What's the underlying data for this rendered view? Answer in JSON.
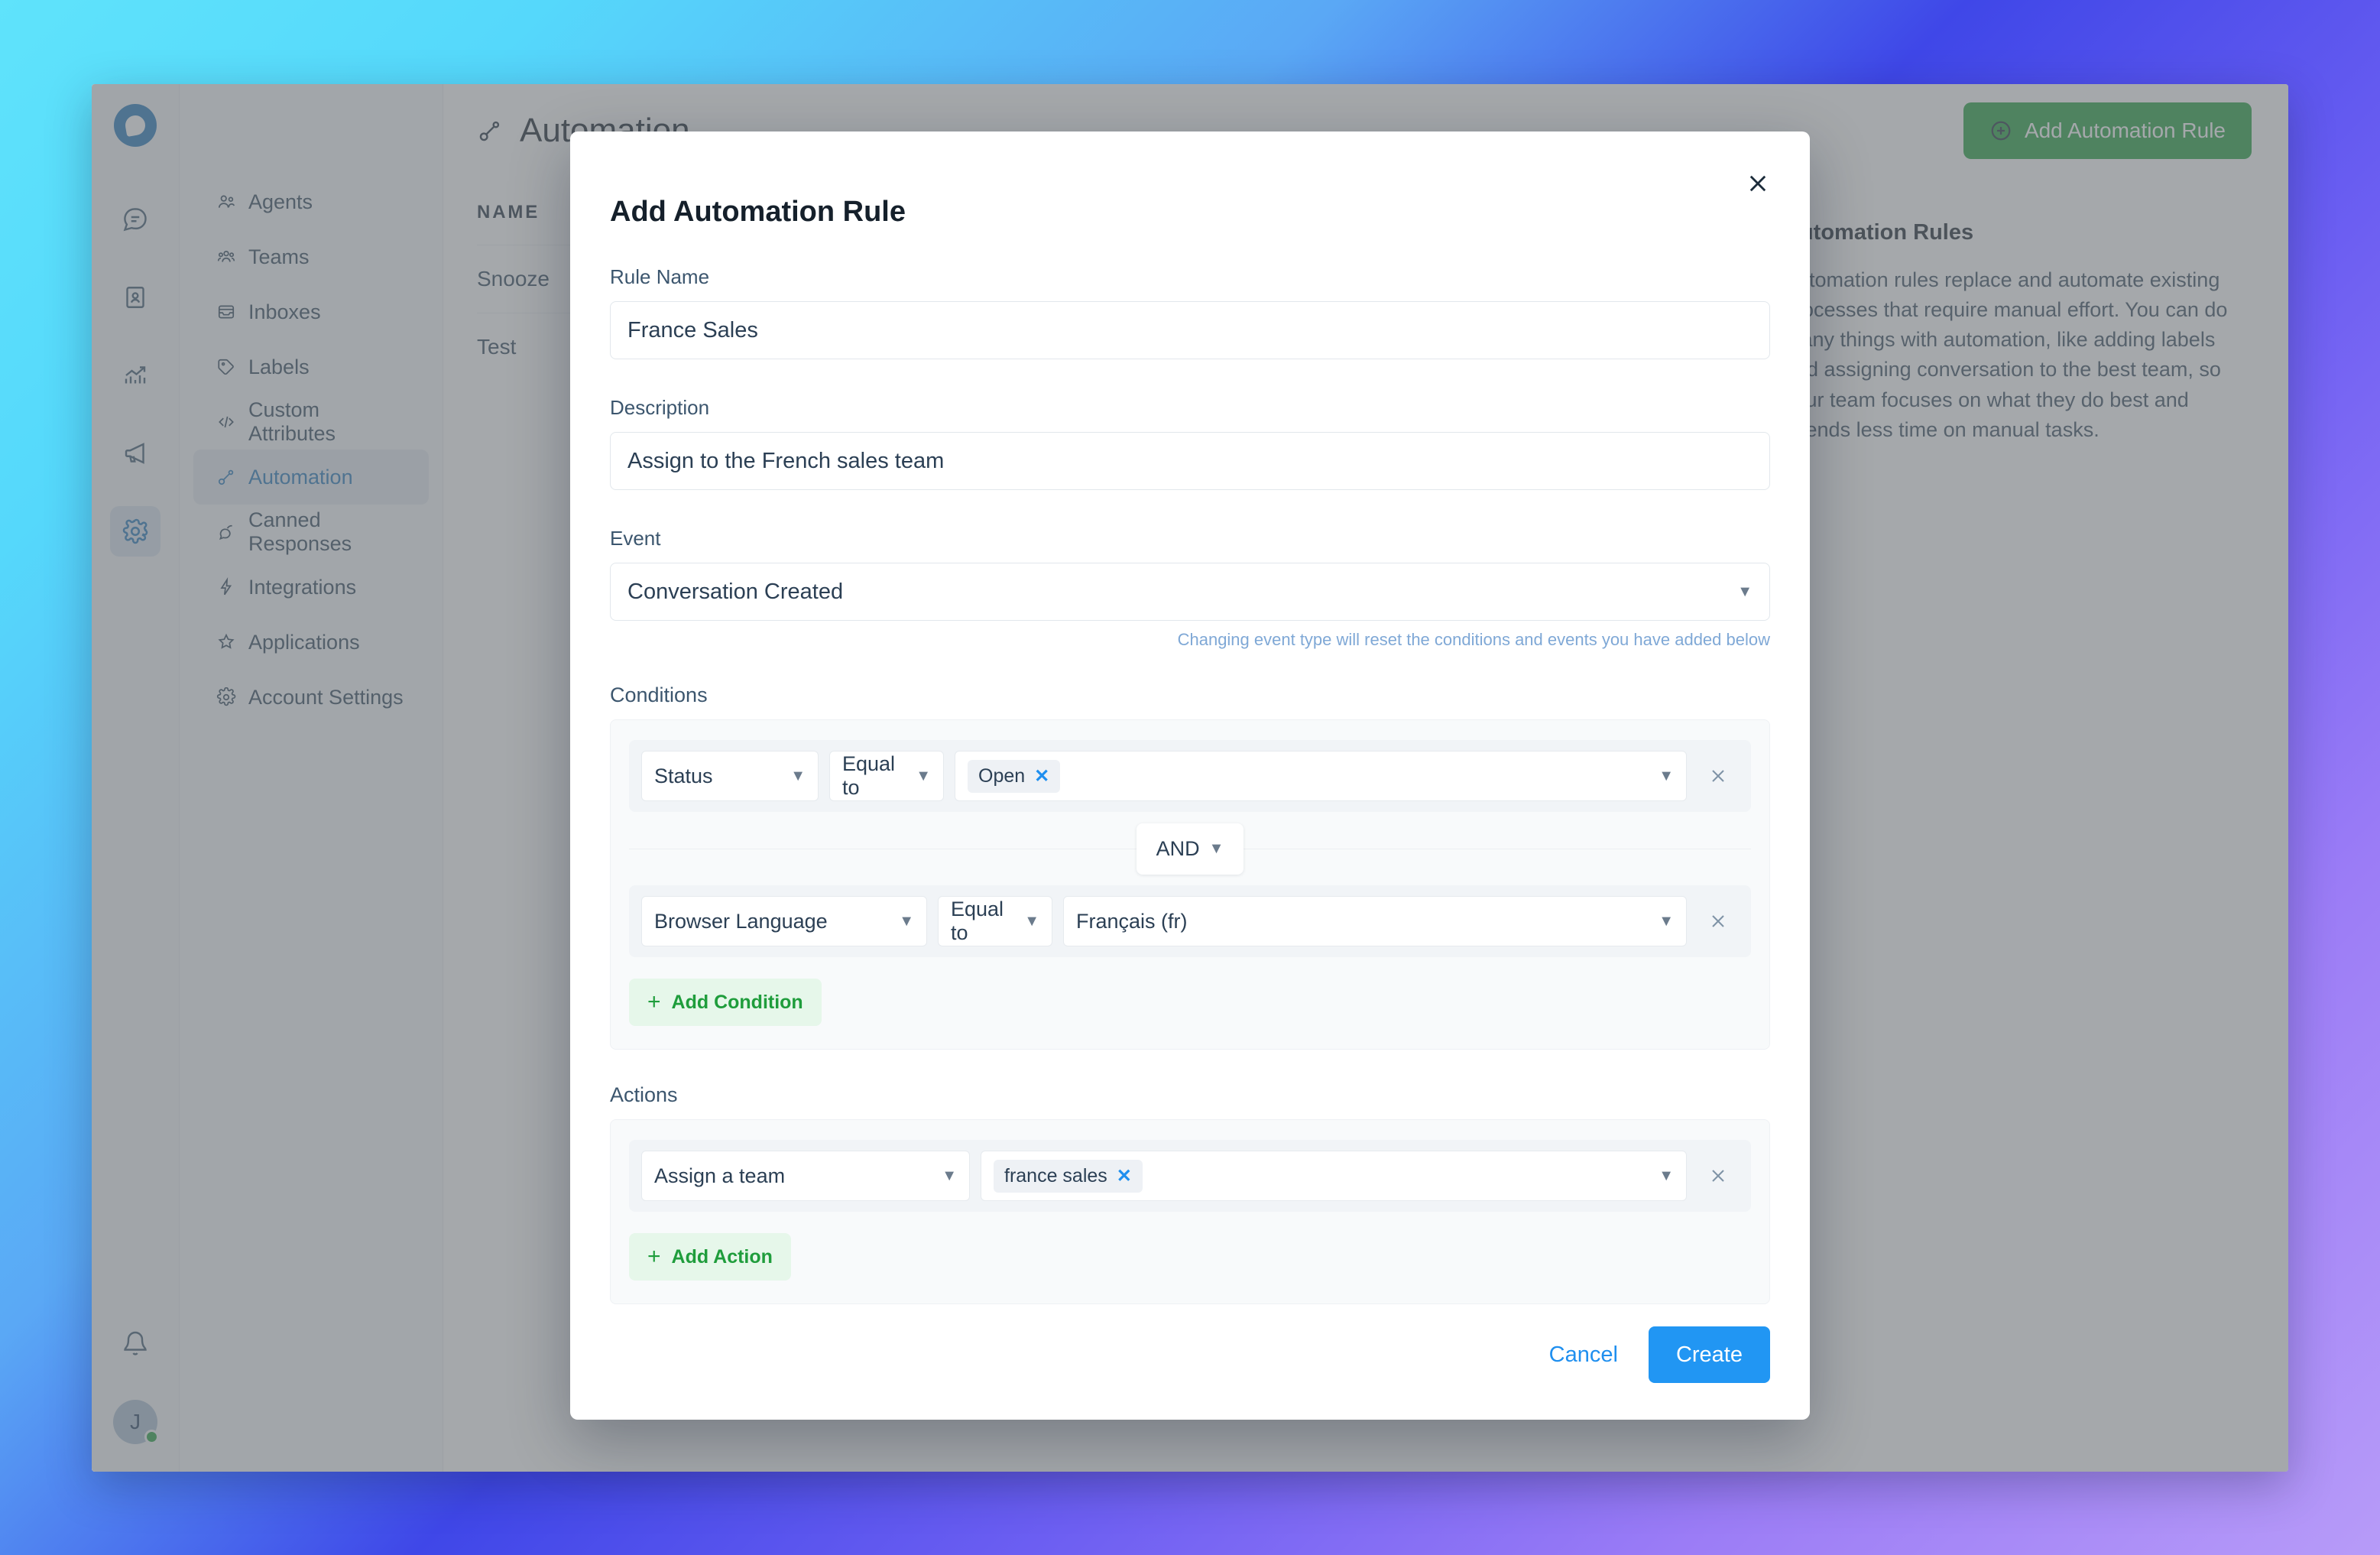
{
  "rail": {
    "logo_icon": "chatwoot-logo-icon",
    "items": [
      {
        "icon": "conversations-icon",
        "name": "conversations",
        "active": false
      },
      {
        "icon": "contacts-book-icon",
        "name": "contacts",
        "active": false
      },
      {
        "icon": "reports-chart-icon",
        "name": "reports",
        "active": false
      },
      {
        "icon": "campaigns-megaphone-icon",
        "name": "campaigns",
        "active": false
      },
      {
        "icon": "settings-gear-icon",
        "name": "settings",
        "active": true
      }
    ],
    "bell_icon": "notifications-bell-icon",
    "avatar_initial": "J",
    "status": "online"
  },
  "sidebar": {
    "items": [
      {
        "label": "Agents",
        "icon": "agents-icon",
        "active": false
      },
      {
        "label": "Teams",
        "icon": "teams-icon",
        "active": false
      },
      {
        "label": "Inboxes",
        "icon": "inboxes-icon",
        "active": false
      },
      {
        "label": "Labels",
        "icon": "labels-tag-icon",
        "active": false
      },
      {
        "label": "Custom Attributes",
        "icon": "code-brackets-icon",
        "active": false
      },
      {
        "label": "Automation",
        "icon": "automation-icon",
        "active": true
      },
      {
        "label": "Canned Responses",
        "icon": "canned-responses-icon",
        "active": false
      },
      {
        "label": "Integrations",
        "icon": "integrations-bolt-icon",
        "active": false
      },
      {
        "label": "Applications",
        "icon": "applications-star-icon",
        "active": false
      },
      {
        "label": "Account Settings",
        "icon": "account-settings-gear-icon",
        "active": false
      }
    ]
  },
  "header": {
    "title": "Automation",
    "title_icon": "automation-icon",
    "add_button": {
      "label": "Add Automation Rule",
      "icon": "plus-circle-icon"
    }
  },
  "table": {
    "columns": [
      "NAME"
    ],
    "rows": [
      {
        "name": "Snooze"
      },
      {
        "name": "Test"
      }
    ]
  },
  "info_panel": {
    "title": "Automation Rules",
    "body": "Automation rules replace and automate existing processes that require manual effort. You can do many things with automation, like adding labels and assigning conversation to the best team, so your team focuses on what they do best and spends less time on manual tasks."
  },
  "modal": {
    "title": "Add Automation Rule",
    "close_icon": "close-icon",
    "rule_name": {
      "label": "Rule Name",
      "value": "France Sales",
      "placeholder": "Rule Name"
    },
    "description": {
      "label": "Description",
      "value": "Assign to the French sales team",
      "placeholder": "Description"
    },
    "event": {
      "label": "Event",
      "value": "Conversation Created",
      "hint": "Changing event type will reset the conditions and events you have added below"
    },
    "conditions": {
      "label": "Conditions",
      "rows": [
        {
          "attribute": "Status",
          "operator": "Equal to",
          "values": [
            {
              "text": "Open",
              "remove_icon": "remove-tag-icon"
            }
          ],
          "value_text": "",
          "remove_icon": "remove-row-icon"
        },
        {
          "attribute": "Browser Language",
          "operator": "Equal to",
          "values": [],
          "value_text": "Français (fr)",
          "remove_icon": "remove-row-icon"
        }
      ],
      "joiner": "AND",
      "add_button": {
        "label": "Add Condition",
        "icon": "plus-icon"
      }
    },
    "actions": {
      "label": "Actions",
      "rows": [
        {
          "action": "Assign a team",
          "values": [
            {
              "text": "france sales",
              "remove_icon": "remove-tag-icon"
            }
          ],
          "remove_icon": "remove-row-icon"
        }
      ],
      "add_button": {
        "label": "Add Action",
        "icon": "plus-icon"
      }
    },
    "footer": {
      "cancel_label": "Cancel",
      "create_label": "Create"
    }
  },
  "colors": {
    "brand_blue": "#1f73b7",
    "primary_blue": "#2196f3",
    "success_green": "#1f9d3c",
    "soft_green_bg": "#e6f7ea",
    "link_blue": "#1f8fef",
    "hint_blue": "#7fa8d6"
  }
}
